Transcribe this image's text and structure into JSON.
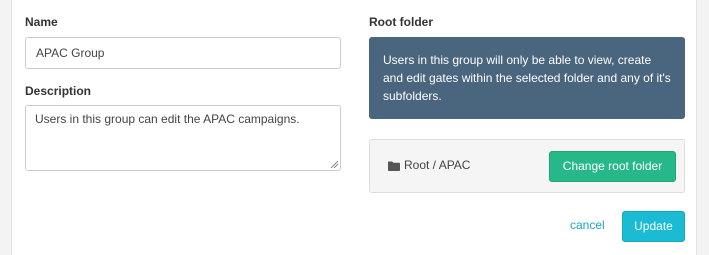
{
  "form": {
    "name_label": "Name",
    "name_value": "APAC Group",
    "description_label": "Description",
    "description_value": "Users in this group can edit the APAC campaigns.",
    "root_folder_label": "Root folder",
    "root_folder_info": "Users in this group will only be able to view, create and edit gates within the selected folder and any of it's subfolders.",
    "current_folder_path": "Root / APAC",
    "change_root_folder_label": "Change root folder",
    "cancel_label": "cancel",
    "update_label": "Update"
  },
  "icons": {
    "folder": "folder-icon",
    "resize": "resize-grip-icon"
  },
  "colors": {
    "info_box_bg": "#4a657e",
    "change_button_bg": "#26b888",
    "update_button_bg": "#1bbbd4",
    "link": "#1aa5c8"
  }
}
